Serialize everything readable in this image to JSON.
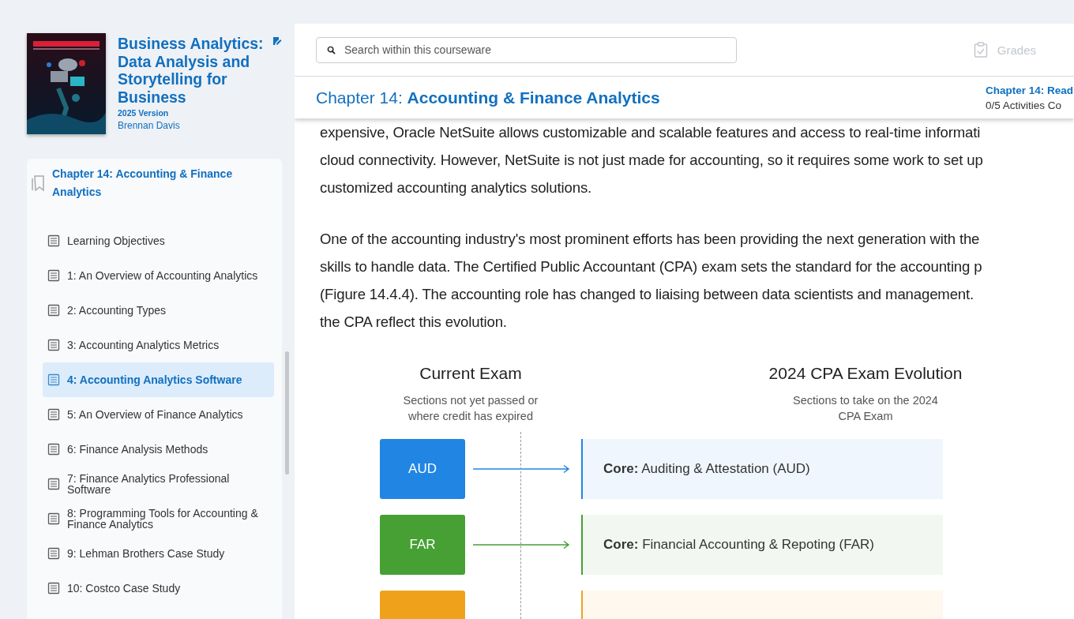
{
  "book": {
    "title": "Business Analytics: Data Analysis and Storytelling for Business",
    "version": "2025 Version",
    "author": "Brennan Davis"
  },
  "toc": {
    "chapter": "Chapter 14: Accounting & Finance Analytics",
    "items": [
      {
        "label": "Learning Objectives",
        "selected": false
      },
      {
        "label": "1: An Overview of Accounting Analytics",
        "selected": false
      },
      {
        "label": "2: Accounting Types",
        "selected": false
      },
      {
        "label": "3: Accounting Analytics Metrics",
        "selected": false
      },
      {
        "label": "4: Accounting Analytics Software",
        "selected": true
      },
      {
        "label": "5: An Overview of Finance Analytics",
        "selected": false
      },
      {
        "label": "6: Finance Analysis Methods",
        "selected": false
      },
      {
        "label": "7: Finance Analytics Professional Software",
        "selected": false
      },
      {
        "label": "8: Programming Tools for Accounting & Finance Analytics",
        "selected": false
      },
      {
        "label": "9: Lehman Brothers Case Study",
        "selected": false
      },
      {
        "label": "10: Costco Case Study",
        "selected": false
      }
    ]
  },
  "search": {
    "placeholder": "Search within this courseware"
  },
  "grades": {
    "label": "Grades",
    "disabled": true
  },
  "chapter_bar": {
    "title": "Chapter 14: **Accounting & Finance Analytics**",
    "progress_title": "Chapter 14: Read",
    "progress": "0/5 Activities Co"
  },
  "paragraphs": [
    [
      "expensive, Oracle NetSuite allows customizable and scalable features and access to real-time informati",
      "cloud connectivity. However, NetSuite is not just made for accounting, so it requires some work to set up",
      "customized accounting analytics solutions."
    ],
    [
      "One of the accounting industry's most prominent efforts has been providing the next generation with the",
      "skills to handle data. The Certified Public Accountant (CPA) exam sets the standard for the accounting p",
      "(Figure 14.4.4). The accounting role has changed to liaising between data scientists and management.",
      "the CPA reflect this evolution."
    ]
  ],
  "figure": {
    "left_heading": "Current Exam",
    "left_subtitle": "Sections not yet passed or where credit has expired",
    "right_heading": "2024 CPA Exam Evolution",
    "right_subtitle": "Sections to take on the 2024 CPA Exam",
    "rows": [
      {
        "code": "AUD",
        "color": "#2185e3",
        "text": "**Core:** Auditing & Attestation (AUD)"
      },
      {
        "code": "FAR",
        "color": "#46a034",
        "text": "**Core:** Financial Accounting & Repoting (FAR)"
      },
      {
        "color": "#f0a11c"
      }
    ]
  }
}
